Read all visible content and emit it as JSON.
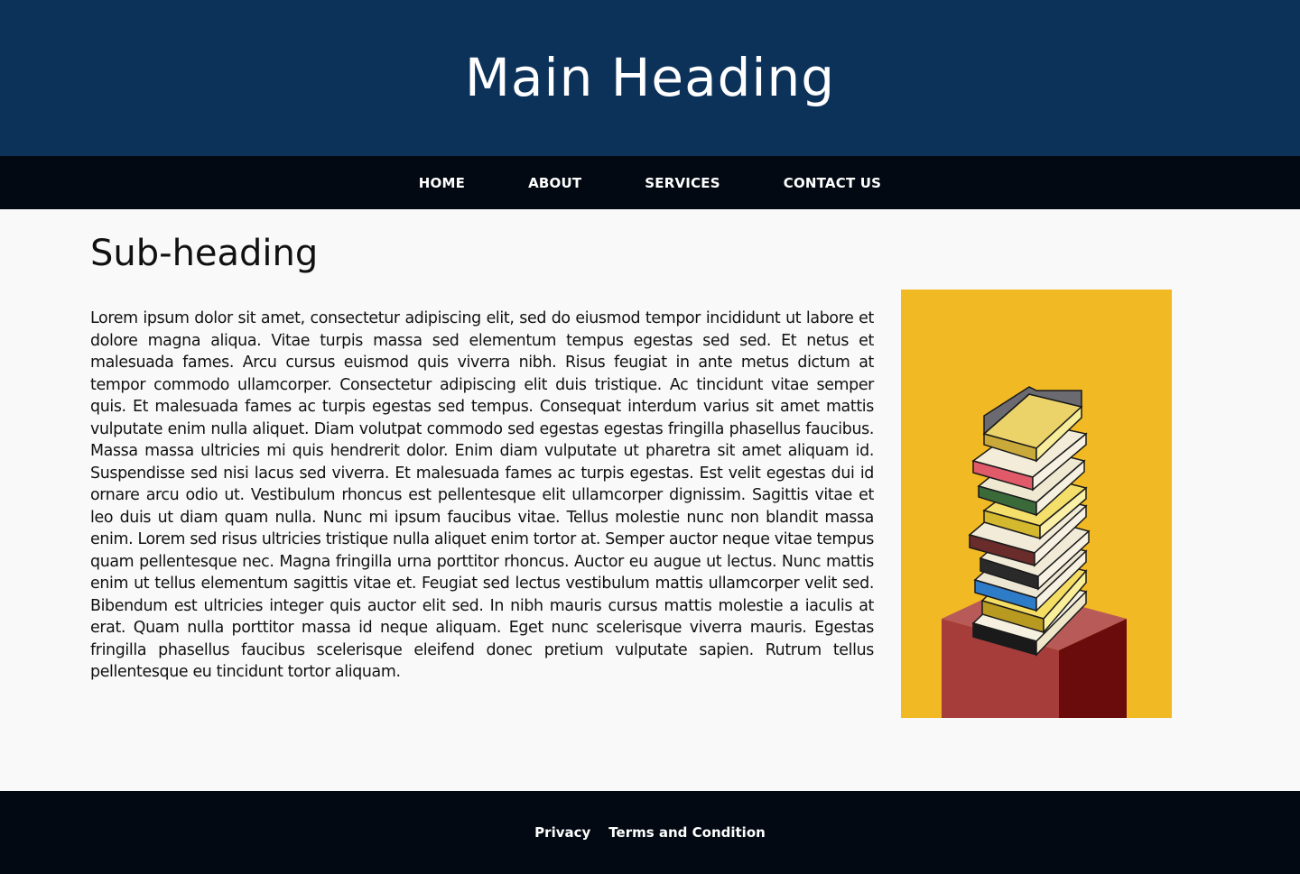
{
  "header": {
    "title": "Main Heading"
  },
  "nav": {
    "items": [
      {
        "label": "HOME"
      },
      {
        "label": "ABOUT"
      },
      {
        "label": "SERVICES"
      },
      {
        "label": "CONTACT US"
      }
    ]
  },
  "main": {
    "subheading": "Sub-heading",
    "paragraph": "Lorem ipsum dolor sit amet, consectetur adipiscing elit, sed do eiusmod tempor incididunt ut labore et dolore magna aliqua. Vitae turpis massa sed elementum tempus egestas sed sed. Et netus et malesuada fames. Arcu cursus euismod quis viverra nibh. Risus feugiat in ante metus dictum at tempor commodo ullamcorper. Consectetur adipiscing elit duis tristique. Ac tincidunt vitae semper quis. Et malesuada fames ac turpis egestas sed tempus. Consequat interdum varius sit amet mattis vulputate enim nulla aliquet. Diam volutpat commodo sed egestas egestas fringilla phasellus faucibus. Massa massa ultricies mi quis hendrerit dolor. Enim diam vulputate ut pharetra sit amet aliquam id. Suspendisse sed nisi lacus sed viverra. Et malesuada fames ac turpis egestas. Est velit egestas dui id ornare arcu odio ut. Vestibulum rhoncus est pellentesque elit ullamcorper dignissim. Sagittis vitae et leo duis ut diam quam nulla. Nunc mi ipsum faucibus vitae. Tellus molestie nunc non blandit massa enim. Lorem sed risus ultricies tristique nulla aliquet enim tortor at. Semper auctor neque vitae tempus quam pellentesque nec. Magna fringilla urna porttitor rhoncus. Auctor eu augue ut lectus. Nunc mattis enim ut tellus elementum sagittis vitae et. Feugiat sed lectus vestibulum mattis ullamcorper velit sed. Bibendum est ultricies integer quis auctor elit sed. In nibh mauris cursus mattis molestie a iaculis at erat. Quam nulla porttitor massa id neque aliquam. Eget nunc scelerisque viverra mauris. Egestas fringilla phasellus faucibus scelerisque eleifend donec pretium vulputate sapien. Rutrum tellus pellentesque eu tincidunt tortor aliquam."
  },
  "footer": {
    "links": [
      {
        "label": "Privacy"
      },
      {
        "label": "Terms and Condition"
      }
    ]
  },
  "colors": {
    "header_bg": "#0c325a",
    "nav_bg": "#020912",
    "footer_bg": "#020912",
    "page_bg": "#f9f9fa",
    "image_bg": "#f1b924"
  }
}
